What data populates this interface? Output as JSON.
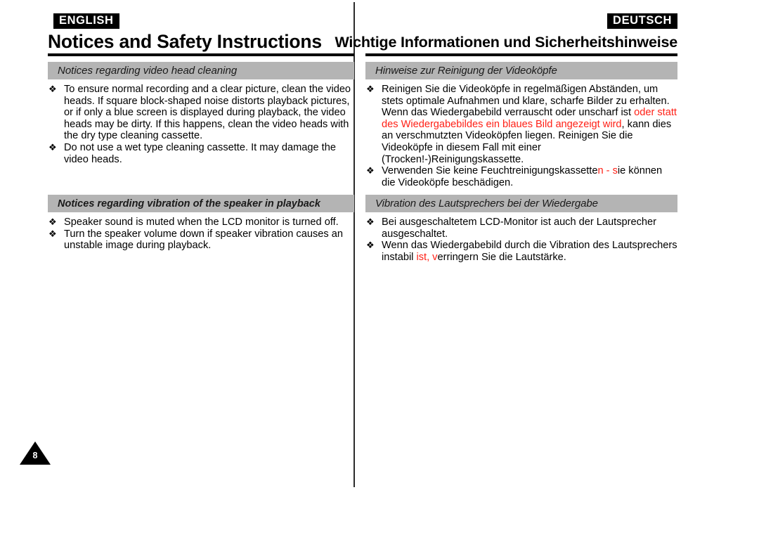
{
  "page": {
    "number": "8",
    "bullet_glyph": "❖"
  },
  "colors": {
    "heading_bar": "#b4b4b4",
    "badge_background": "#000000",
    "badge_text": "#ffffff",
    "highlight_red": "#ff2016",
    "rule": "#000000"
  },
  "left_column": {
    "language_badge": "ENGLISH",
    "title": "Notices and Safety Instructions",
    "sections": [
      {
        "heading": "Notices regarding video head cleaning",
        "heading_style": "italic",
        "bullets": [
          [
            {
              "text": "To ensure normal recording and a clear picture, clean the video heads. If square block-shaped noise distorts playback pictures, or if only a blue screen is displayed during playback, the video heads may be dirty. If this happens, clean the video heads with the dry type cleaning cassette.",
              "color": "black"
            }
          ],
          [
            {
              "text": "Do not use a wet type cleaning cassette. It may damage the video heads.",
              "color": "black"
            }
          ]
        ]
      },
      {
        "heading": "Notices regarding vibration of the speaker in playback",
        "heading_style": "bold-italic",
        "bullets": [
          [
            {
              "text": "Speaker sound is muted when the LCD monitor is turned off.",
              "color": "black"
            }
          ],
          [
            {
              "text": "Turn the speaker volume down if speaker vibration causes an unstable image during playback.",
              "color": "black"
            }
          ]
        ]
      }
    ]
  },
  "right_column": {
    "language_badge": "DEUTSCH",
    "title": "Wichtige Informationen und Sicherheitshinweise",
    "sections": [
      {
        "heading": "Hinweise zur Reinigung der Videoköpfe",
        "heading_style": "italic",
        "bullets": [
          [
            {
              "text": "Reinigen Sie die Videoköpfe in regelmäßigen Abständen, um stets optimale Aufnahmen und klare, scharfe Bilder zu erhalten. Wenn das Wiedergabebild verrauscht oder unscharf ist ",
              "color": "black"
            },
            {
              "text": "oder statt des Wiedergabebildes ein blaues Bild angezeigt wird",
              "color": "red"
            },
            {
              "text": ", kann dies an verschmutzten Videoköpfen liegen. Reinigen Sie die Videoköpfe in diesem Fall mit einer (Trocken!-)Reinigungskassette.",
              "color": "black"
            }
          ],
          [
            {
              "text": "Verwenden Sie keine Feuchtreinigungskassette",
              "color": "black"
            },
            {
              "text": "n - s",
              "color": "red"
            },
            {
              "text": "ie können die Videoköpfe beschädigen.",
              "color": "black"
            }
          ]
        ]
      },
      {
        "heading": "Vibration des Lautsprechers bei der Wiedergabe",
        "heading_style": "italic",
        "bullets": [
          [
            {
              "text": "Bei ausgeschaltetem LCD-Monitor ist auch der Lautsprecher ausgeschaltet.",
              "color": "black"
            }
          ],
          [
            {
              "text": "Wenn das Wiedergabebild durch die Vibration des Lautsprechers instabil ",
              "color": "black"
            },
            {
              "text": "ist, v",
              "color": "red"
            },
            {
              "text": "erringern Sie die Lautstärke.",
              "color": "black"
            }
          ]
        ]
      }
    ]
  }
}
